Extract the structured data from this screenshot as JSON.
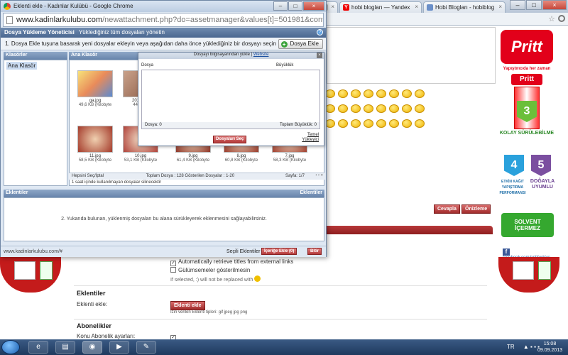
{
  "background_browser": {
    "tabs": [
      {
        "label": "",
        "favicon": "page-icon"
      },
      {
        "label": "hobi blogları — Yandex",
        "favicon": "Y"
      },
      {
        "label": "Hobi Blogları - hobiblog",
        "favicon": "page-icon"
      }
    ],
    "smiley_count": 24,
    "buttons": {
      "preview": "Cevapla",
      "quote": "Önizleme"
    },
    "options": {
      "auto_titles": "Automatically retrieve titles from external links",
      "disable_smilies": "Gülümsemeler gösterilmesin",
      "note": "If selected, :) will not be replaced with"
    },
    "attachments_section": {
      "title": "Eklentiler",
      "label": "Eklenti ekle:",
      "button": "Eklenti ekle",
      "allowed": "İzin verilen Eklenti tipleri: gif jpeg jpg png"
    },
    "subscriptions_section": {
      "title": "Abonelikler",
      "label": "Konu Abonelik ayarları:"
    },
    "ad": {
      "brand": "Pritt",
      "slogan": "Yapıştırıcıda her zaman",
      "brand2": "Pritt",
      "items": [
        {
          "num": "3",
          "text": "KOLAY SÜRÜLEBİLME"
        },
        {
          "num": "4",
          "text": "ETKİN KAĞIT YAPIŞTIRMA PERFORMANSI"
        },
        {
          "num": "5",
          "text": "DOĞAYLA UYUMLU"
        }
      ],
      "solvent": "SOLVENT İÇERMEZ",
      "facebook": "facebook.com/prittturkiye"
    }
  },
  "popup": {
    "window_title": "Eklenti ekle - Kadınlar Kulübü - Google Chrome",
    "url_host": "www.kadinlarkulubu.com",
    "url_path": "/newattachment.php?do=assetmanager&values[t]=501981&contenttypeid",
    "manager_title": "Dosya Yükleme Yöneticisi",
    "manager_subtitle": "Yüklediğiniz tüm dosyaları yönetin",
    "instruction": "1. Dosya Ekle tuşuna basarak yeni dosyalar ekleyin veya aşağıdan daha önce yüklediğiniz bir dosyayı seçin",
    "add_button": "Dosya Ekle",
    "folders_header": "Klasörler",
    "folder_item": "Ana Klasör",
    "files_header": "Ana Klasör",
    "thumbnails": [
      {
        "name": "ga.jpg",
        "size": "49,6 KB (Kilobyte"
      },
      {
        "name": "2013-08-",
        "size": "44,6 KB"
      },
      {
        "name": "11.jpg",
        "size": "58,5 KB (Kilobyte"
      },
      {
        "name": "10.jpg",
        "size": "53,1 KB (Kilobyte"
      },
      {
        "name": "9.jpg",
        "size": "61,4 KB (Kilobyte"
      },
      {
        "name": "8.jpg",
        "size": "60,8 KB (Kilobyte"
      },
      {
        "name": "7.jpg",
        "size": "58,3 KB (Kilobyte"
      }
    ],
    "select_all": "Hepsini Seç/İptal",
    "totals": "Toplam Dosya : 128 Gösterilen Dosyalar : 1-20",
    "page": "Sayfa: 1/7",
    "note": "1 saat içinde kullanılmayan dosyalar silinecektir",
    "upload_dialog": {
      "title": "Dosyayı bilgisayarından yükle",
      "title_link": "Website",
      "col_file": "Dosya",
      "col_size": "Büyüklük",
      "file_count": "Dosya: 0",
      "total_size": "Toplam Büyüklük: 0",
      "select_button": "Dosyaları Seç",
      "basic_link_1": "Temel",
      "basic_link_2": "Yükleyici"
    },
    "attachments_header": "Eklentiler",
    "attachments_header_right": "Eklentiler",
    "drop_hint": "2. Yukarıda bulunan, yüklenmiş dosyaları bu alana sürükleyerek eklenmesini sağlayabilirsiniz.",
    "status_url": "www.kadinlarkulubu.com/#",
    "selected_label": "Seçili Eklentiler :",
    "insert_button": "İçeriğe Ekle (0)",
    "close_button": "Bitir"
  },
  "taskbar": {
    "lang": "TR",
    "time": "15:08",
    "date": "09.09.2013"
  },
  "colors": {
    "accent_red": "#b33a3a",
    "header_blue": "#4a6790",
    "taskbar": "#1f3a5e"
  }
}
